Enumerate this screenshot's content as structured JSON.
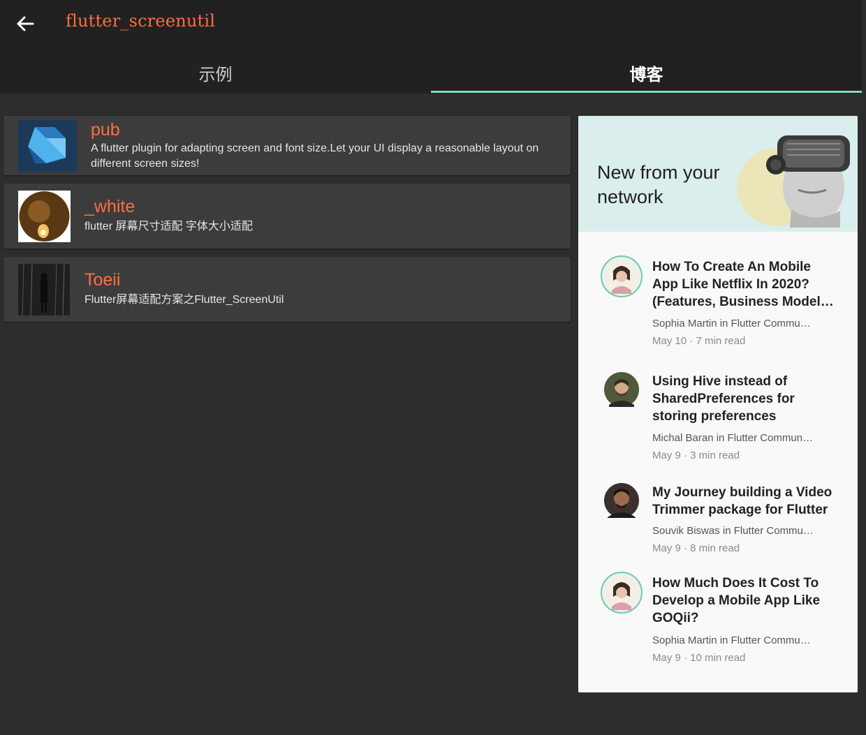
{
  "app": {
    "title": "flutter_screenutil",
    "back_icon": "arrow-left-icon"
  },
  "tabs": [
    {
      "label": "示例",
      "selected": false
    },
    {
      "label": "博客",
      "selected": true
    }
  ],
  "colors": {
    "accent": "#ff6e40",
    "indicator": "#7fd8c4",
    "appbar": "#212121",
    "card": "#3c3c3c"
  },
  "links": [
    {
      "title": "pub",
      "desc": "A flutter plugin for adapting screen and font size.Let your UI display a reasonable layout on different screen sizes!",
      "icon": "dart-logo-icon"
    },
    {
      "title": "_white",
      "desc": "flutter 屏幕尺寸适配 字体大小适配",
      "icon": "avatar-photo"
    },
    {
      "title": "Toeii",
      "desc": "Flutter屏幕适配方案之Flutter_ScreenUtil",
      "icon": "avatar-photo"
    }
  ],
  "network": {
    "banner_text": "New from your network",
    "stories": [
      {
        "title": "How To Create An Mobile App Like Netflix In 2020? (Features, Business Model…",
        "author": "Sophia Martin in Flutter Commu…",
        "date": "May 10 · 7 min read"
      },
      {
        "title": "Using Hive instead of SharedPreferences for storing preferences",
        "author": "Michal Baran in Flutter Commun…",
        "date": "May 9 · 3 min read"
      },
      {
        "title": "My Journey building a Video Trimmer package for Flutter",
        "author": "Souvik Biswas in Flutter Commu…",
        "date": "May 9 · 8 min read"
      },
      {
        "title": "How Much Does It Cost To Develop a Mobile App Like GOQii?",
        "author": "Sophia Martin in Flutter Commu…",
        "date": "May 9 · 10 min read"
      }
    ]
  }
}
